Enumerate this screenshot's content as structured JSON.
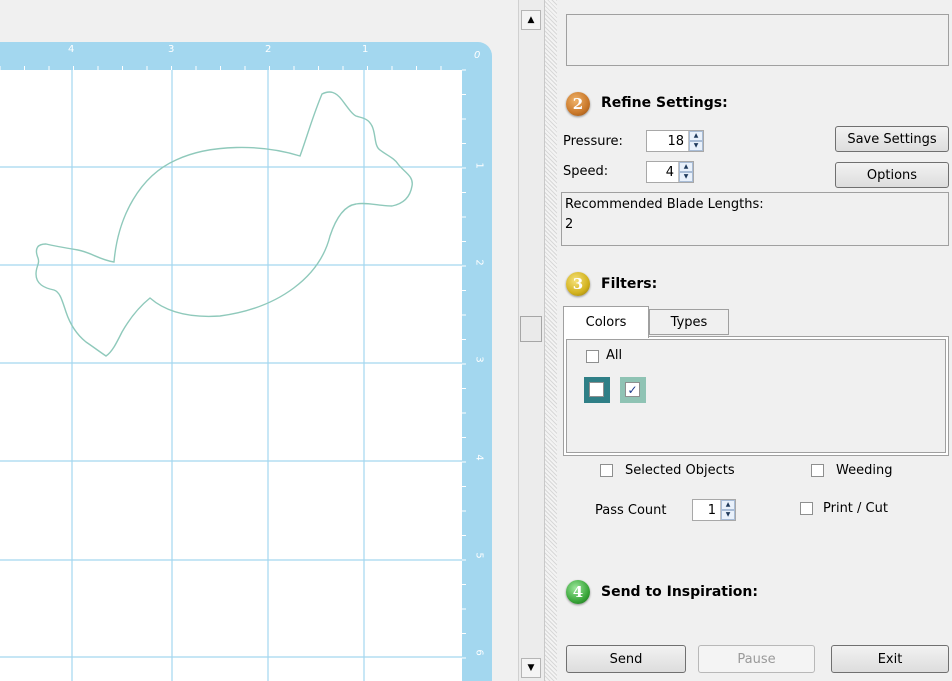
{
  "ruler": {
    "top_labels": [
      "4",
      "3",
      "2",
      "1",
      "0"
    ],
    "right_labels": [
      "1",
      "2",
      "3",
      "4",
      "5",
      "6"
    ]
  },
  "colors": {
    "mat_blue": "#a3d7ef",
    "grid_line": "#a3d7ef",
    "candy_outline": "#8fc9bb",
    "badge_refine": "#c9782a",
    "badge_filters": "#d2b21e",
    "badge_send": "#3aa63a",
    "swatch_1": "#2f7f86",
    "swatch_2": "#8fc3b4"
  },
  "refine": {
    "badge": "2",
    "title": "Refine Settings:",
    "pressure_label": "Pressure:",
    "pressure_value": "18",
    "speed_label": "Speed:",
    "speed_value": "4",
    "save_settings_label": "Save Settings",
    "options_label": "Options",
    "blade_title": "Recommended Blade Lengths:",
    "blade_value": "2"
  },
  "filters": {
    "badge": "3",
    "title": "Filters:",
    "tabs": [
      "Colors",
      "Types"
    ],
    "active_tab": "Colors",
    "all_label": "All",
    "swatches": [
      {
        "color": "#2f7f86",
        "checked": false
      },
      {
        "color": "#8fc3b4",
        "checked": true
      }
    ],
    "selected_objects_label": "Selected Objects",
    "weeding_label": "Weeding",
    "pass_count_label": "Pass Count",
    "pass_count_value": "1",
    "print_cut_label": "Print / Cut"
  },
  "send": {
    "badge": "4",
    "title": "Send to Inspiration:",
    "send_label": "Send",
    "pause_label": "Pause",
    "exit_label": "Exit"
  }
}
